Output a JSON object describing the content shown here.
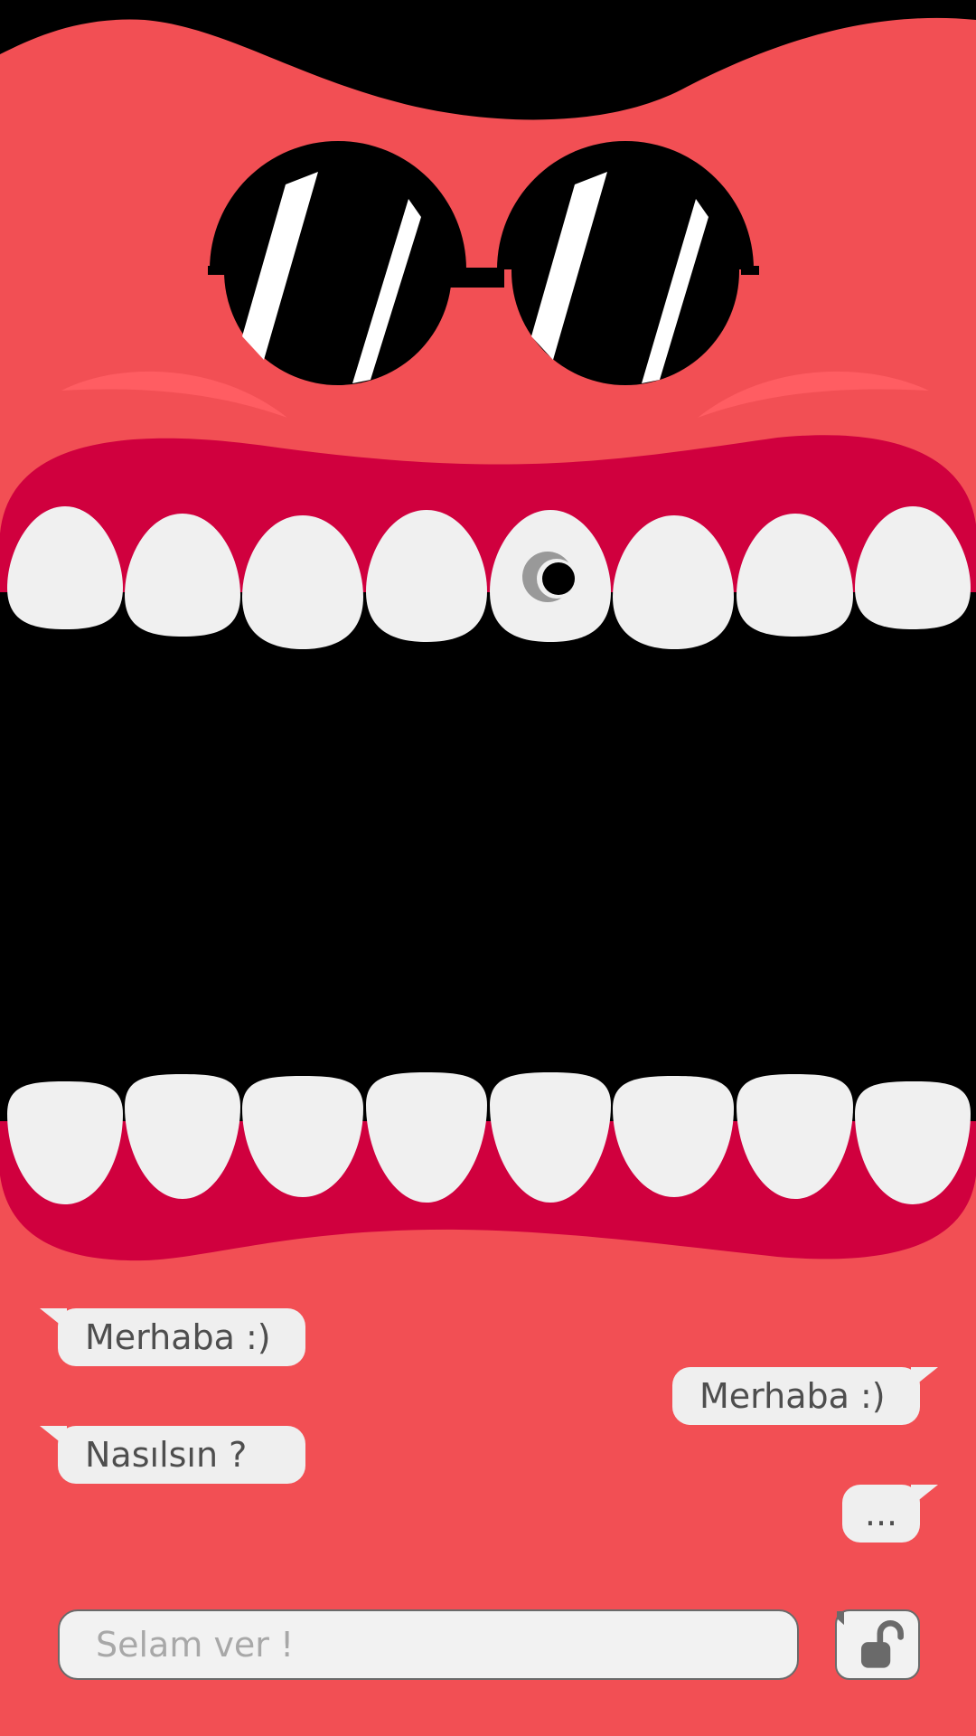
{
  "colors": {
    "face": "#f24f54",
    "lips": "#d0003e",
    "mouth": "#000000",
    "teeth": "#f0f0f0",
    "bubble": "#efefef",
    "text": "#4e4e4e",
    "placeholder": "#a8a8a8"
  },
  "chat": {
    "messages": [
      {
        "side": "left",
        "text": "Merhaba :)"
      },
      {
        "side": "right",
        "text": "Merhaba :)"
      },
      {
        "side": "left",
        "text": "Nasılsın ?"
      },
      {
        "side": "right",
        "text": "..."
      }
    ]
  },
  "composer": {
    "placeholder": "Selam ver !",
    "value": "",
    "send_icon": "unlocked-padlock-icon"
  },
  "character": {
    "eyewear_icon": "sunglasses-icon",
    "piercing_icon": "tooth-piercing-icon"
  }
}
